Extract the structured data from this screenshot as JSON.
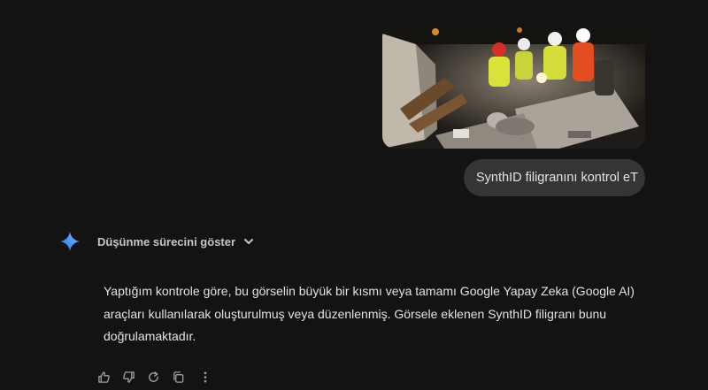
{
  "user_message": {
    "image_icon": "photo-rescue-workers-rubble",
    "text": "SynthID filigranını kontrol eT"
  },
  "assistant": {
    "logo_icon": "gemini-sparkle-icon",
    "thinking_toggle_label": "Düşünme sürecini göster",
    "response_text": "Yaptığım kontrole göre, bu görselin büyük bir kısmı veya tamamı Google Yapay Zeka (Google AI) araçları kullanılarak oluşturulmuş veya düzenlenmiş. Görsele eklenen SynthID filigranı bunu doğrulamaktadır.",
    "actions": [
      {
        "name": "thumbs-up-icon"
      },
      {
        "name": "thumbs-down-icon"
      },
      {
        "name": "regenerate-icon"
      },
      {
        "name": "copy-icon"
      },
      {
        "name": "more-options-icon"
      }
    ]
  },
  "colors": {
    "background": "#131314",
    "bubble": "#333537",
    "text": "#e3e3e3",
    "secondary_text": "#c4c7c5",
    "gemini_blue": "#4796e3"
  }
}
